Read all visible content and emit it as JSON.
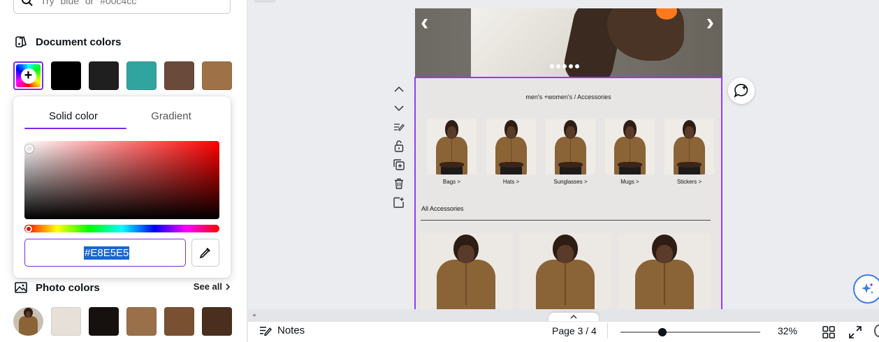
{
  "search": {
    "placeholder": "Try \"blue\" or \"#00c4cc\""
  },
  "document_colors": {
    "title": "Document colors",
    "swatches": [
      "#000000",
      "#1f1f1f",
      "#32a49f",
      "#6a4a3a",
      "#9e7246"
    ]
  },
  "color_picker": {
    "tabs": [
      "Solid color",
      "Gradient"
    ],
    "active_tab": "Solid color",
    "hex_value": "#E8E5E5"
  },
  "photo_colors": {
    "title": "Photo colors",
    "see_all": "See all",
    "swatches": [
      "#e6e0d8",
      "#16110e",
      "#9a704a",
      "#7a5032",
      "#4a2f1f"
    ]
  },
  "canvas": {
    "breadcrumb": "men's +women's / Accessories",
    "categories": [
      "Bags >",
      "Hats >",
      "Sunglasses >",
      "Mugs >",
      "Stickers >"
    ],
    "section_heading": "All Accessories",
    "selection_color": "#8b3dff",
    "page_background": "#E8E5E5"
  },
  "bottom_bar": {
    "notes_label": "Notes",
    "page_indicator": "Page 3 / 4",
    "zoom_label": "32%"
  },
  "icons": [
    "search-icon",
    "palette-icon",
    "image-icon",
    "chevron-right-icon",
    "eyedropper-icon",
    "chevron-up-icon",
    "chevron-down-icon",
    "edit-lines-icon",
    "lock-icon",
    "duplicate-icon",
    "trash-icon",
    "add-page-icon",
    "comment-icon",
    "magic-sparkle-icon",
    "notes-icon",
    "grid-icon",
    "fullscreen-icon"
  ]
}
